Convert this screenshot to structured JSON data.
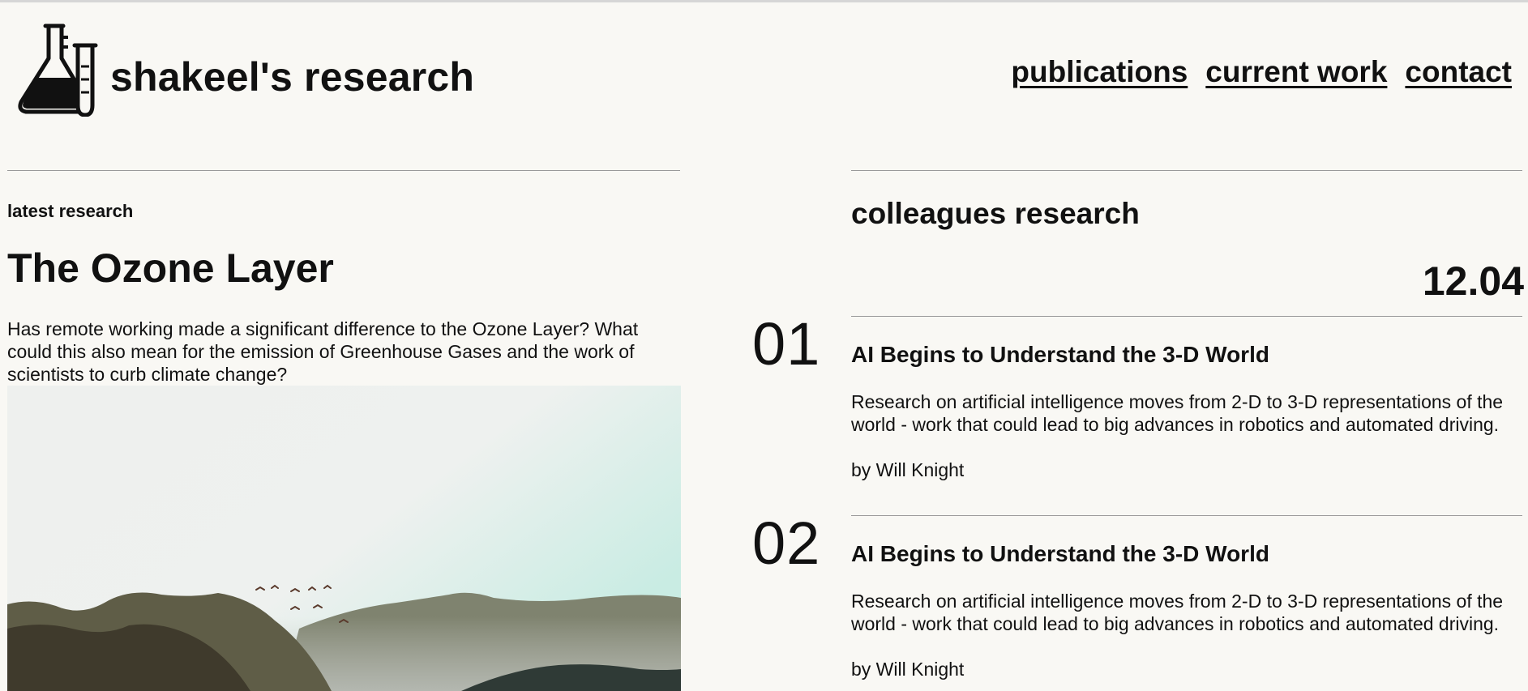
{
  "header": {
    "site_title": "shakeel's research",
    "nav": [
      {
        "label": "publications"
      },
      {
        "label": "current work"
      },
      {
        "label": "contact"
      }
    ]
  },
  "latest": {
    "section_label": "latest research",
    "title": "The Ozone Layer",
    "description": "Has remote working made a significant difference to the Ozone Layer? What could this also mean for the emission of Greenhouse Gases and the work of scientists to curb climate change?"
  },
  "colleagues": {
    "heading": "colleagues research",
    "date": "12.04",
    "items": [
      {
        "number": "01",
        "title": "AI Begins to Understand the 3-D World",
        "description": "Research on artificial intelligence moves from 2-D to 3-D representations of the world - work that could lead to big advances in robotics and automated driving.",
        "author": "by Will Knight"
      },
      {
        "number": "02",
        "title": "AI Begins to Understand the 3-D World",
        "description": "Research on artificial intelligence moves from 2-D to 3-D representations of the world - work that could lead to big advances in robotics and automated driving.",
        "author": "by Will Knight"
      }
    ]
  }
}
